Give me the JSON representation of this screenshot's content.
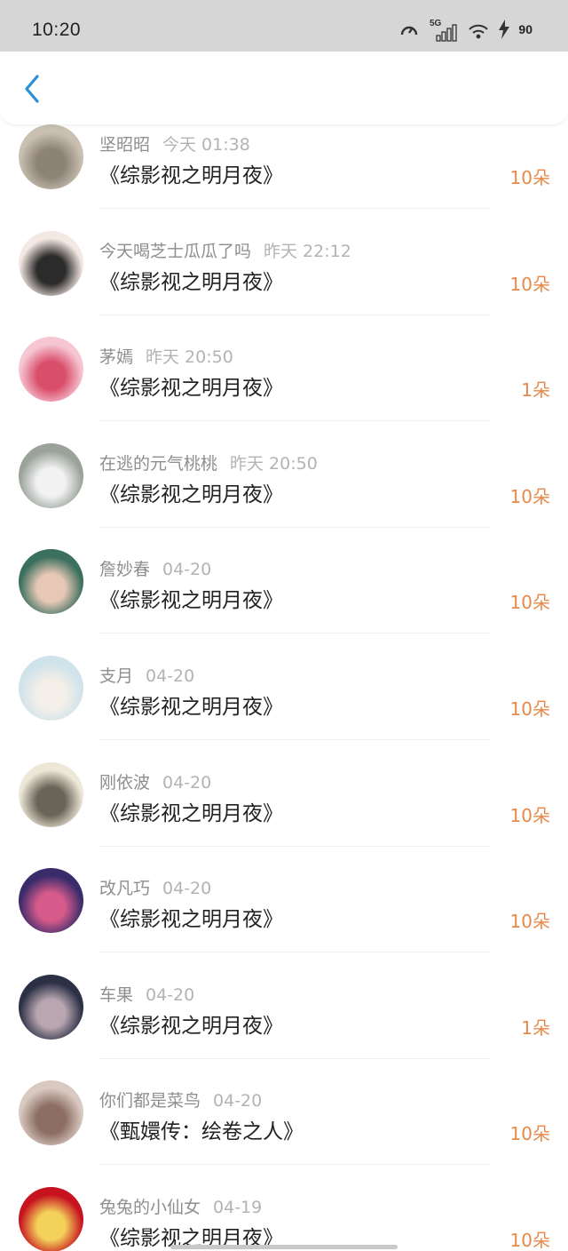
{
  "status": {
    "time": "10:20",
    "network": "5G",
    "battery": "90"
  },
  "list": [
    {
      "name": "坚昭昭",
      "time": "今天 01:38",
      "title": "《综影视之明月夜》",
      "amount": "10朵",
      "avatar_colors": [
        "#c9c0b2",
        "#8d8276"
      ]
    },
    {
      "name": "今天喝芝士瓜瓜了吗",
      "time": "昨天 22:12",
      "title": "《综影视之明月夜》",
      "amount": "10朵",
      "avatar_colors": [
        "#f3e8e2",
        "#2b2b2b"
      ]
    },
    {
      "name": "茅嫣",
      "time": "昨天 20:50",
      "title": "《综影视之明月夜》",
      "amount": "1朵",
      "avatar_colors": [
        "#f6c6d3",
        "#d94f6b"
      ]
    },
    {
      "name": "在逃的元气桃桃",
      "time": "昨天 20:50",
      "title": "《综影视之明月夜》",
      "amount": "10朵",
      "avatar_colors": [
        "#9aa29a",
        "#f2f2f2"
      ]
    },
    {
      "name": "詹妙春",
      "time": "04-20",
      "title": "《综影视之明月夜》",
      "amount": "10朵",
      "avatar_colors": [
        "#3b6f5e",
        "#e7c7b5"
      ]
    },
    {
      "name": "支月",
      "time": "04-20",
      "title": "《综影视之明月夜》",
      "amount": "10朵",
      "avatar_colors": [
        "#cfe3ea",
        "#f4efe8"
      ]
    },
    {
      "name": "刚依波",
      "time": "04-20",
      "title": "《综影视之明月夜》",
      "amount": "10朵",
      "avatar_colors": [
        "#ece7d6",
        "#6a6458"
      ]
    },
    {
      "name": "改凡巧",
      "time": "04-20",
      "title": "《综影视之明月夜》",
      "amount": "10朵",
      "avatar_colors": [
        "#3a2c6b",
        "#d65a8a"
      ]
    },
    {
      "name": "车果",
      "time": "04-20",
      "title": "《综影视之明月夜》",
      "amount": "1朵",
      "avatar_colors": [
        "#2b3045",
        "#b9a6b0"
      ]
    },
    {
      "name": "你们都是菜鸟",
      "time": "04-20",
      "title": "《甄嬛传：绘卷之人》",
      "amount": "10朵",
      "avatar_colors": [
        "#d9c9c1",
        "#8c6e63"
      ]
    },
    {
      "name": "兔兔的小仙女",
      "time": "04-19",
      "title": "《综影视之明月夜》",
      "amount": "10朵",
      "avatar_colors": [
        "#c7121f",
        "#f3d15a"
      ]
    }
  ],
  "colors": {
    "accent_amount": "#e8894a",
    "back_arrow": "#2a8fd8"
  }
}
